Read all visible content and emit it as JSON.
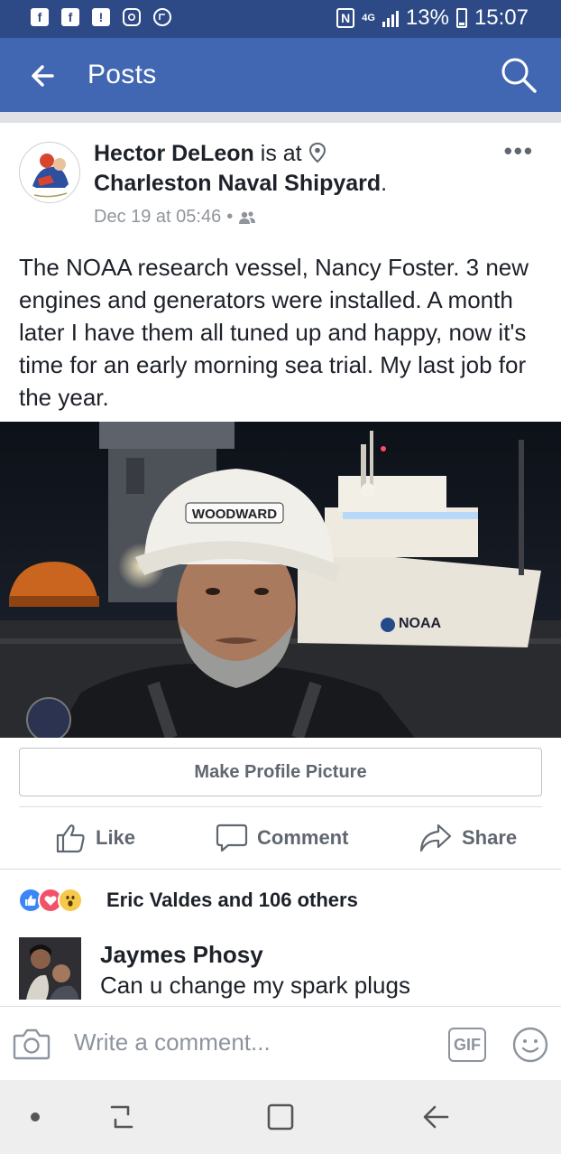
{
  "status_bar": {
    "network": "4G",
    "battery": "13%",
    "time": "15:07"
  },
  "app_bar": {
    "title": "Posts"
  },
  "post": {
    "author": "Hector DeLeon",
    "is_at": "is at",
    "place": "Charleston Naval Shipyard",
    "place_suffix": ".",
    "timestamp": "Dec 19 at 05:46",
    "meta_sep": "•",
    "text": "The NOAA research vessel,  Nancy Foster.  3 new engines and generators were installed. A month later I have them all tuned up and happy, now it's time for an early morning sea trial.  My last job for the year.",
    "photo_hat_text": "WOODWARD",
    "photo_ship_text": "NOAA"
  },
  "profile_button": "Make Profile Picture",
  "actions": {
    "like": "Like",
    "comment": "Comment",
    "share": "Share"
  },
  "reactions": {
    "summary": "Eric Valdes and 106 others",
    "icons": [
      "like-icon",
      "love-icon",
      "wow-icon"
    ]
  },
  "comment": {
    "name": "Jaymes Phosy",
    "text": "Can u change my spark plugs"
  },
  "composer": {
    "placeholder": "Write a comment...",
    "gif_label": "GIF"
  },
  "colors": {
    "status_bar": "#2d4a86",
    "app_bar": "#4267b2",
    "secondary_text": "#606770",
    "meta_text": "#90949c"
  }
}
